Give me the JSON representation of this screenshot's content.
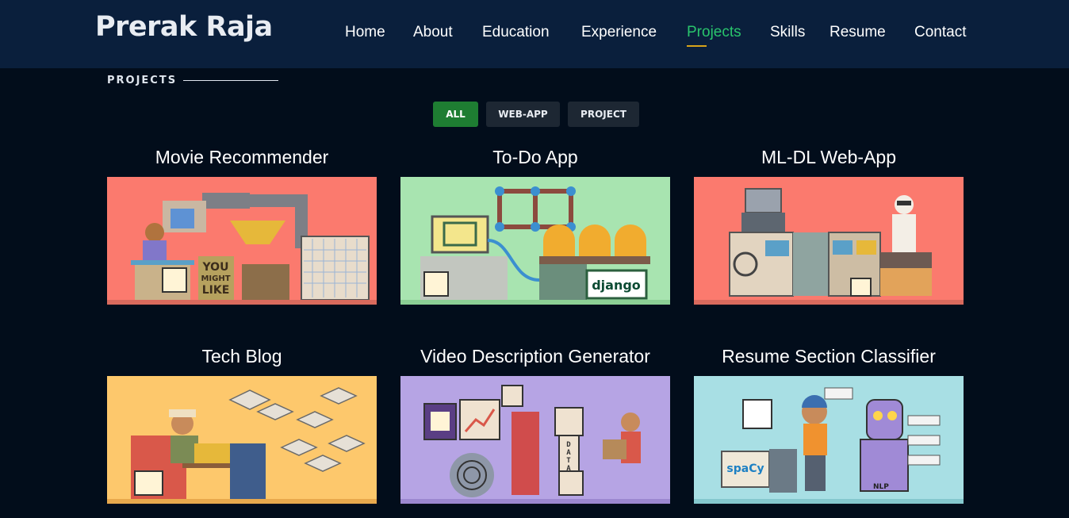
{
  "brand": "Prerak Raja",
  "nav": [
    {
      "label": "Home",
      "active": false
    },
    {
      "label": "About",
      "active": false
    },
    {
      "label": "Education",
      "active": false
    },
    {
      "label": "Experience",
      "active": false
    },
    {
      "label": "Projects",
      "active": true
    },
    {
      "label": "Skills",
      "active": false
    },
    {
      "label": "Resume",
      "active": false
    },
    {
      "label": "Contact",
      "active": false
    }
  ],
  "section": {
    "label": "PROJECTS"
  },
  "filters": [
    {
      "label": "ALL",
      "active": true
    },
    {
      "label": "WEB-APP",
      "active": false
    },
    {
      "label": "PROJECT",
      "active": false
    }
  ],
  "projects": [
    {
      "title": "Movie Recommender",
      "bg": "#fb7a6e",
      "art": [
        "YOU",
        "MIGHT",
        "LIKE"
      ]
    },
    {
      "title": "To-Do App",
      "bg": "#a8e4b0",
      "art": [
        "django"
      ]
    },
    {
      "title": "ML-DL Web-App",
      "bg": "#fb7a6e",
      "art": []
    },
    {
      "title": "Tech Blog",
      "bg": "#fdc86c",
      "art": []
    },
    {
      "title": "Video Description Generator",
      "bg": "#b6a4e4",
      "art": [
        "D",
        "A",
        "T",
        "A"
      ]
    },
    {
      "title": "Resume Section Classifier",
      "bg": "#a8dfe4",
      "art": [
        "spaCy",
        "NLP"
      ]
    }
  ],
  "colors": {
    "navbar": "#0a1f3c",
    "page": "#020d1b",
    "accent_green": "#29c46c",
    "filter_active": "#1e7d32",
    "underline": "#d8a31a"
  }
}
